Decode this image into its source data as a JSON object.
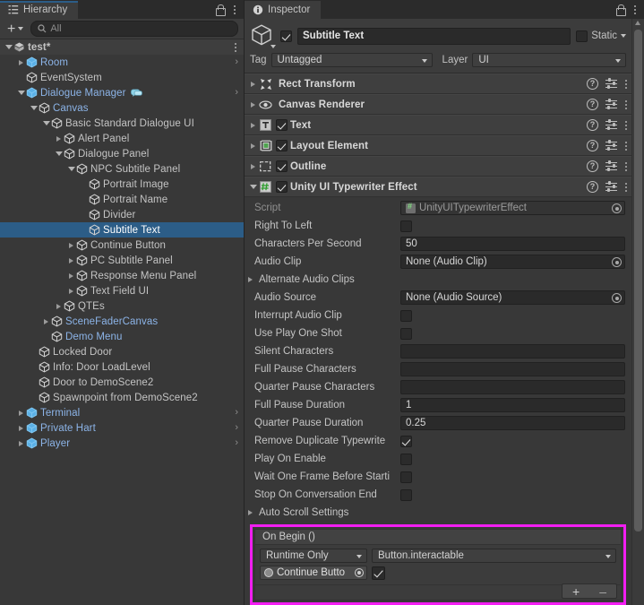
{
  "hierarchy": {
    "tab_label": "Hierarchy",
    "tab_icon": "hierarchy-list-icon",
    "toolbar": {
      "add_label": "+",
      "search_placeholder": "All",
      "search_value": ""
    },
    "rows": [
      {
        "label": "test*",
        "indent": 1,
        "twisty": "down",
        "icon": "unity-scene-icon",
        "kebab": true,
        "scene": true,
        "color": "normal"
      },
      {
        "label": "Room",
        "indent": 2,
        "twisty": "right",
        "icon": "prefab-cube-icon",
        "chevron": true,
        "color": "blue"
      },
      {
        "label": "EventSystem",
        "indent": 2,
        "twisty": "none",
        "icon": "gameobject-cube-icon",
        "color": "normal"
      },
      {
        "label": "Dialogue Manager",
        "indent": 2,
        "twisty": "down",
        "icon": "prefab-cube-icon",
        "badge": "dialogue-bubble-icon",
        "chevron": true,
        "color": "blue"
      },
      {
        "label": "Canvas",
        "indent": 3,
        "twisty": "down",
        "icon": "gameobject-cube-icon",
        "color": "blue"
      },
      {
        "label": "Basic Standard Dialogue UI",
        "indent": 4,
        "twisty": "down",
        "icon": "gameobject-cube-icon",
        "color": "normal"
      },
      {
        "label": "Alert Panel",
        "indent": 5,
        "twisty": "right",
        "icon": "gameobject-cube-icon",
        "color": "normal"
      },
      {
        "label": "Dialogue Panel",
        "indent": 5,
        "twisty": "down",
        "icon": "gameobject-cube-icon",
        "color": "normal"
      },
      {
        "label": "NPC Subtitle Panel",
        "indent": 6,
        "twisty": "down",
        "icon": "gameobject-cube-icon",
        "color": "normal"
      },
      {
        "label": "Portrait Image",
        "indent": 7,
        "twisty": "none",
        "icon": "gameobject-cube-icon",
        "color": "normal"
      },
      {
        "label": "Portrait Name",
        "indent": 7,
        "twisty": "none",
        "icon": "gameobject-cube-icon",
        "color": "normal"
      },
      {
        "label": "Divider",
        "indent": 7,
        "twisty": "none",
        "icon": "gameobject-cube-icon",
        "color": "normal"
      },
      {
        "label": "Subtitle Text",
        "indent": 7,
        "twisty": "none",
        "icon": "gameobject-cube-icon",
        "color": "normal",
        "selected": true
      },
      {
        "label": "Continue Button",
        "indent": 6,
        "twisty": "right",
        "icon": "gameobject-cube-icon",
        "color": "normal"
      },
      {
        "label": "PC Subtitle Panel",
        "indent": 6,
        "twisty": "right",
        "icon": "gameobject-cube-icon",
        "color": "normal"
      },
      {
        "label": "Response Menu Panel",
        "indent": 6,
        "twisty": "right",
        "icon": "gameobject-cube-icon",
        "color": "normal"
      },
      {
        "label": "Text Field UI",
        "indent": 6,
        "twisty": "right",
        "icon": "gameobject-cube-icon",
        "color": "normal"
      },
      {
        "label": "QTEs",
        "indent": 5,
        "twisty": "right",
        "icon": "gameobject-cube-icon",
        "color": "normal"
      },
      {
        "label": "SceneFaderCanvas",
        "indent": 4,
        "twisty": "right",
        "icon": "gameobject-cube-icon",
        "color": "blue"
      },
      {
        "label": "Demo Menu",
        "indent": 4,
        "twisty": "none",
        "icon": "gameobject-cube-icon",
        "color": "blue"
      },
      {
        "label": "Locked Door",
        "indent": 3,
        "twisty": "none",
        "icon": "gameobject-cube-icon",
        "color": "normal"
      },
      {
        "label": "Info: Door LoadLevel",
        "indent": 3,
        "twisty": "none",
        "icon": "gameobject-cube-icon",
        "color": "normal"
      },
      {
        "label": "Door to DemoScene2",
        "indent": 3,
        "twisty": "none",
        "icon": "gameobject-cube-icon",
        "color": "normal"
      },
      {
        "label": "Spawnpoint from DemoScene2",
        "indent": 3,
        "twisty": "none",
        "icon": "gameobject-cube-icon",
        "color": "normal"
      },
      {
        "label": "Terminal",
        "indent": 2,
        "twisty": "right",
        "icon": "prefab-cube-icon",
        "chevron": true,
        "color": "blue"
      },
      {
        "label": "Private Hart",
        "indent": 2,
        "twisty": "right",
        "icon": "prefab-cube-icon",
        "chevron": true,
        "color": "blue"
      },
      {
        "label": "Player",
        "indent": 2,
        "twisty": "right",
        "icon": "prefab-cube-icon",
        "chevron": true,
        "color": "blue"
      }
    ]
  },
  "inspector": {
    "tab_label": "Inspector",
    "tab_icon": "info-circle-icon",
    "object": {
      "enabled": true,
      "name": "Subtitle Text",
      "static_label": "Static",
      "static_checked": false,
      "tag_label": "Tag",
      "tag_value": "Untagged",
      "layer_label": "Layer",
      "layer_value": "UI"
    },
    "components": [
      {
        "name": "Rect Transform",
        "icon": "rect-transform-icon",
        "expanded": false,
        "has_checkbox": false
      },
      {
        "name": "Canvas Renderer",
        "icon": "eye-icon",
        "expanded": false,
        "has_checkbox": false
      },
      {
        "name": "Text",
        "icon": "text-t-icon",
        "expanded": false,
        "has_checkbox": true,
        "checked": true
      },
      {
        "name": "Layout Element",
        "icon": "layout-element-icon",
        "expanded": false,
        "has_checkbox": true,
        "checked": true
      },
      {
        "name": "Outline",
        "icon": "outline-rect-icon",
        "expanded": false,
        "has_checkbox": true,
        "checked": true
      },
      {
        "name": "Unity UI Typewriter Effect",
        "icon": "cs-script-icon",
        "expanded": true,
        "has_checkbox": true,
        "checked": true
      }
    ],
    "properties": [
      {
        "label": "Script",
        "type": "objref-readonly",
        "value": "UnityUITypewriterEffect",
        "dim": true
      },
      {
        "label": "Right To Left",
        "type": "checkbox",
        "checked": false
      },
      {
        "label": "Characters Per Second",
        "type": "text",
        "value": "50"
      },
      {
        "label": "Audio Clip",
        "type": "objref",
        "value": "None (Audio Clip)"
      },
      {
        "label": "Alternate Audio Clips",
        "type": "foldout",
        "expanded": false
      },
      {
        "label": "Audio Source",
        "type": "objref",
        "value": "None (Audio Source)"
      },
      {
        "label": "Interrupt Audio Clip",
        "type": "checkbox",
        "checked": false
      },
      {
        "label": "Use Play One Shot",
        "type": "checkbox",
        "checked": false
      },
      {
        "label": "Silent Characters",
        "type": "text",
        "value": ""
      },
      {
        "label": "Full Pause Characters",
        "type": "text",
        "value": ""
      },
      {
        "label": "Quarter Pause Characters",
        "type": "text",
        "value": ""
      },
      {
        "label": "Full Pause Duration",
        "type": "text",
        "value": "1"
      },
      {
        "label": "Quarter Pause Duration",
        "type": "text",
        "value": "0.25"
      },
      {
        "label": "Remove Duplicate Typewrite",
        "type": "checkbox",
        "checked": true
      },
      {
        "label": "Play On Enable",
        "type": "checkbox",
        "checked": false
      },
      {
        "label": "Wait One Frame Before Starti",
        "type": "checkbox",
        "checked": false
      },
      {
        "label": "Stop On Conversation End",
        "type": "checkbox",
        "checked": false
      },
      {
        "label": "Auto Scroll Settings",
        "type": "foldout",
        "expanded": false
      }
    ],
    "event": {
      "highlighted": true,
      "highlight_color": "#f21ef2",
      "title": "On Begin ()",
      "mode_value": "Runtime Only",
      "function_value": "Button.interactable",
      "target_object": "Continue Butto",
      "argument_checked": true,
      "add_label": "+",
      "remove_label": "–"
    }
  }
}
